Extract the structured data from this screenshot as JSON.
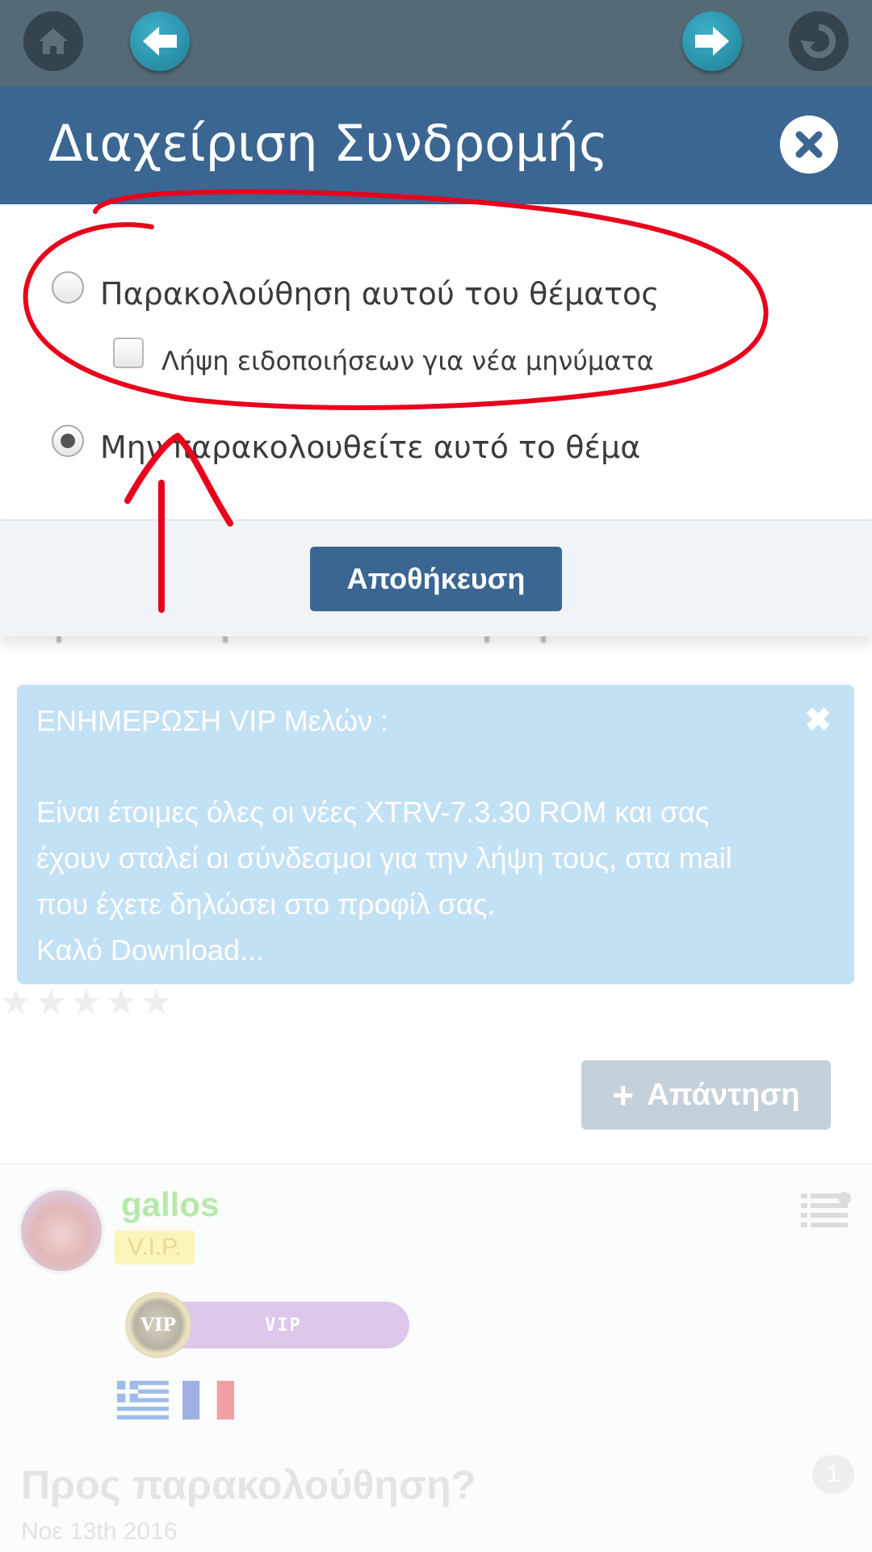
{
  "toolbar": {
    "home_icon": "home-icon",
    "back_icon": "arrow-left-icon",
    "forward_icon": "arrow-right-icon",
    "refresh_icon": "refresh-icon"
  },
  "modal": {
    "title": "Διαχείριση Συνδρομής",
    "options": [
      {
        "label": "Παρακολούθηση αυτού του θέματος",
        "checked": false
      },
      {
        "label": "Μην παρακολουθείτε αυτό το θέμα",
        "checked": true
      }
    ],
    "email_checkbox_label": "Λήψη ειδοποιήσεων για νέα μηνύματα",
    "save_label": "Αποθήκευση"
  },
  "notice": {
    "title": "ΕΝΗΜΕΡΩΣΗ VIP Μελών :",
    "body": "Είναι έτοιμες όλες οι νέες XTRV-7.3.30 ROM και σας\nέχουν σταλεί οι σύνδεσμοι για την λήψη τους, στα mail\nπου έχετε δηλώσει στο προφίλ σας.\nΚαλό Download..."
  },
  "rating": {
    "stars": 5,
    "filled": 0
  },
  "reply_button": {
    "label": "Απάντηση"
  },
  "post": {
    "username": "gallos",
    "rank": "V.I.P.",
    "badge_text": "VIP",
    "coin_text": "VIP",
    "flags": [
      "greece-flag",
      "france-flag"
    ],
    "thread_title": "Προς παρακολούθηση?",
    "thread_date": "Νοε 13th 2016",
    "count": "1"
  },
  "colors": {
    "toolbar": "#546a76",
    "modal_header": "#3a6691",
    "notice_bg": "#c3e1f4",
    "annotation": "#e8001c"
  }
}
